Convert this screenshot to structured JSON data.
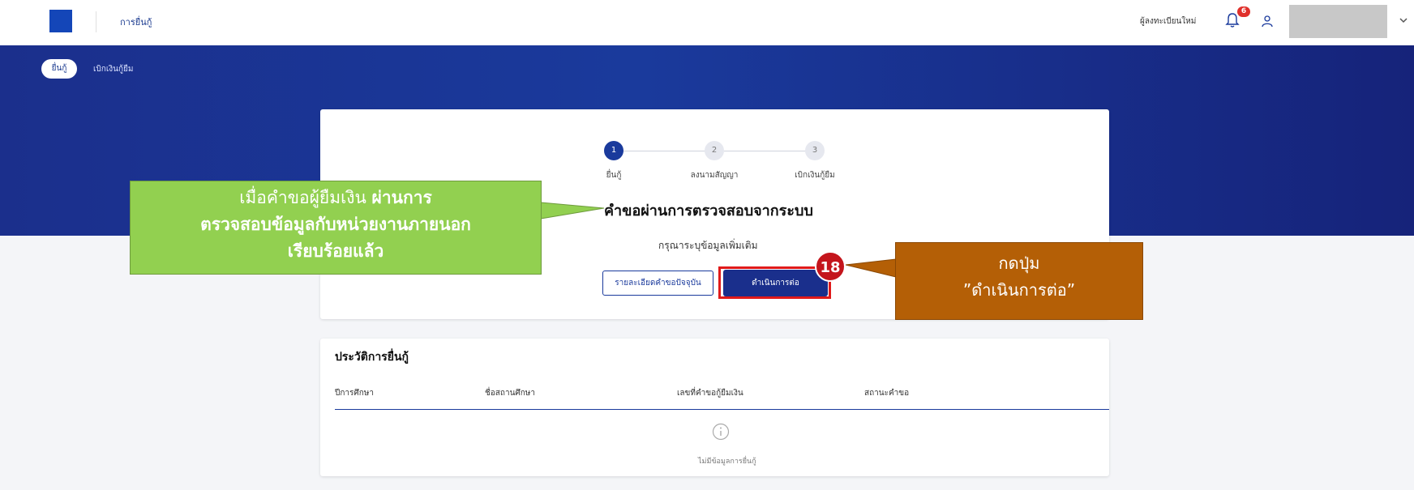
{
  "header": {
    "app_title": "การยื่นกู้",
    "register_link": "ผู้ลงทะเบียนใหม่",
    "notification_count": "6"
  },
  "banner": {
    "tabs": [
      {
        "label": "ยื่นกู้",
        "active": true
      },
      {
        "label": "เบิกเงินกู้ยืม",
        "active": false
      }
    ]
  },
  "steps": [
    {
      "number": "1",
      "label": "ยื่นกู้",
      "active": true
    },
    {
      "number": "2",
      "label": "ลงนามสัญญา",
      "active": false
    },
    {
      "number": "3",
      "label": "เบิกเงินกู้ยืม",
      "active": false
    }
  ],
  "status": {
    "title": "คำขอผ่านการตรวจสอบจากระบบ",
    "subtitle": "กรุณาระบุข้อมูลเพิ่มเติม",
    "details_button": "รายละเอียดคำขอปัจจุบัน",
    "continue_button": "ดำเนินการต่อ"
  },
  "history": {
    "title": "ประวัติการยื่นกู้",
    "columns": [
      "ปีการศึกษา",
      "ชื่อสถานศึกษา",
      "เลขที่คำขอกู้ยืมเงิน",
      "สถานะคำขอ"
    ],
    "empty_text": "ไม่มีข้อมูลการยื่นกู้"
  },
  "annotations": {
    "green_line1_normal": "เมื่อคำขอผู้ยืมเงิน ",
    "green_line1_bold": "ผ่านการ",
    "green_line2": "ตรวจสอบข้อมูลกับหน่วยงานภายนอก",
    "green_line3": "เรียบร้อยแล้ว",
    "brown_line1": "กดปุ่ม",
    "brown_line2": "”ดำเนินการต่อ”",
    "step_number": "18"
  },
  "colors": {
    "brand": "#1a3a9c",
    "callout_green": "#92d050",
    "callout_brown": "#b45f06",
    "highlight_red": "#e01a1a"
  }
}
